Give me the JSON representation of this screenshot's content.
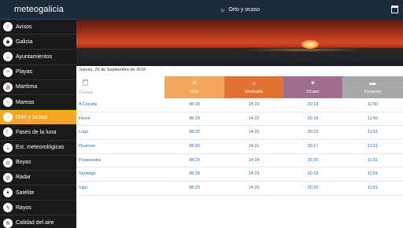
{
  "app": {
    "brand": "meteogalicia"
  },
  "header": {
    "title": "Orto y ocaso",
    "title_icon": "sunset-icon",
    "calendar_icon": "calendar-icon"
  },
  "sidebar": {
    "items": [
      {
        "label": "Avisos",
        "icon": "warning-icon",
        "glyph": "!"
      },
      {
        "label": "Galicia",
        "icon": "map-icon",
        "glyph": "◆"
      },
      {
        "label": "Ayuntamientos",
        "icon": "town-icon",
        "glyph": "⌂"
      },
      {
        "label": "Playas",
        "icon": "beach-icon",
        "glyph": "≈"
      },
      {
        "label": "Marítima",
        "icon": "sailboat-icon",
        "glyph": "⛵"
      },
      {
        "label": "Mareas",
        "icon": "tide-icon",
        "glyph": "~"
      },
      {
        "label": "Orto y ocaso",
        "icon": "sunset-icon",
        "glyph": "☼",
        "active": true
      },
      {
        "label": "Fases de la luna",
        "icon": "moon-icon",
        "glyph": "☾"
      },
      {
        "label": "Est. meteorológicas",
        "icon": "station-icon",
        "glyph": "⊥"
      },
      {
        "label": "Boyas",
        "icon": "buoy-icon",
        "glyph": "⊙"
      },
      {
        "label": "Radar",
        "icon": "radar-icon",
        "glyph": "◎"
      },
      {
        "label": "Satélite",
        "icon": "satellite-icon",
        "glyph": "✦"
      },
      {
        "label": "Rayos",
        "icon": "lightning-icon",
        "glyph": "ϟ"
      },
      {
        "label": "Calidad del aire",
        "icon": "air-icon",
        "glyph": "≋"
      }
    ]
  },
  "main": {
    "date": "Jueves, 29 de Septiembre de 2016",
    "city_header": "Ciudad",
    "columns": [
      {
        "label": "Orto",
        "color": "#f4a65a",
        "glyph": "☀"
      },
      {
        "label": "Mediodía",
        "color": "#e07330",
        "glyph": "☼"
      },
      {
        "label": "Ocaso",
        "color": "#9f6e8e",
        "glyph": "☀"
      },
      {
        "label": "Duración",
        "color": "#a8a8a8",
        "glyph": "▬"
      }
    ],
    "rows": [
      {
        "city": "A Coruña",
        "orto": "08:28",
        "mediodia": "14:23",
        "ocaso": "20:19",
        "duracion": "11:50"
      },
      {
        "city": "Ferrol",
        "orto": "08:28",
        "mediodia": "14:22",
        "ocaso": "20:18",
        "duracion": "11:50"
      },
      {
        "city": "Lugo",
        "orto": "08:25",
        "mediodia": "14:20",
        "ocaso": "20:15",
        "duracion": "11:51"
      },
      {
        "city": "Ourense",
        "orto": "08:26",
        "mediodia": "14:21",
        "ocaso": "20:17",
        "duracion": "11:51"
      },
      {
        "city": "Pontevedra",
        "orto": "08:29",
        "mediodia": "14:24",
        "ocaso": "20:20",
        "duracion": "11:51"
      },
      {
        "city": "Santiago",
        "orto": "08:28",
        "mediodia": "14:23",
        "ocaso": "20:19",
        "duracion": "11:51"
      },
      {
        "city": "Vigo",
        "orto": "08:29",
        "mediodia": "14:25",
        "ocaso": "20:20",
        "duracion": "11:51"
      }
    ]
  }
}
